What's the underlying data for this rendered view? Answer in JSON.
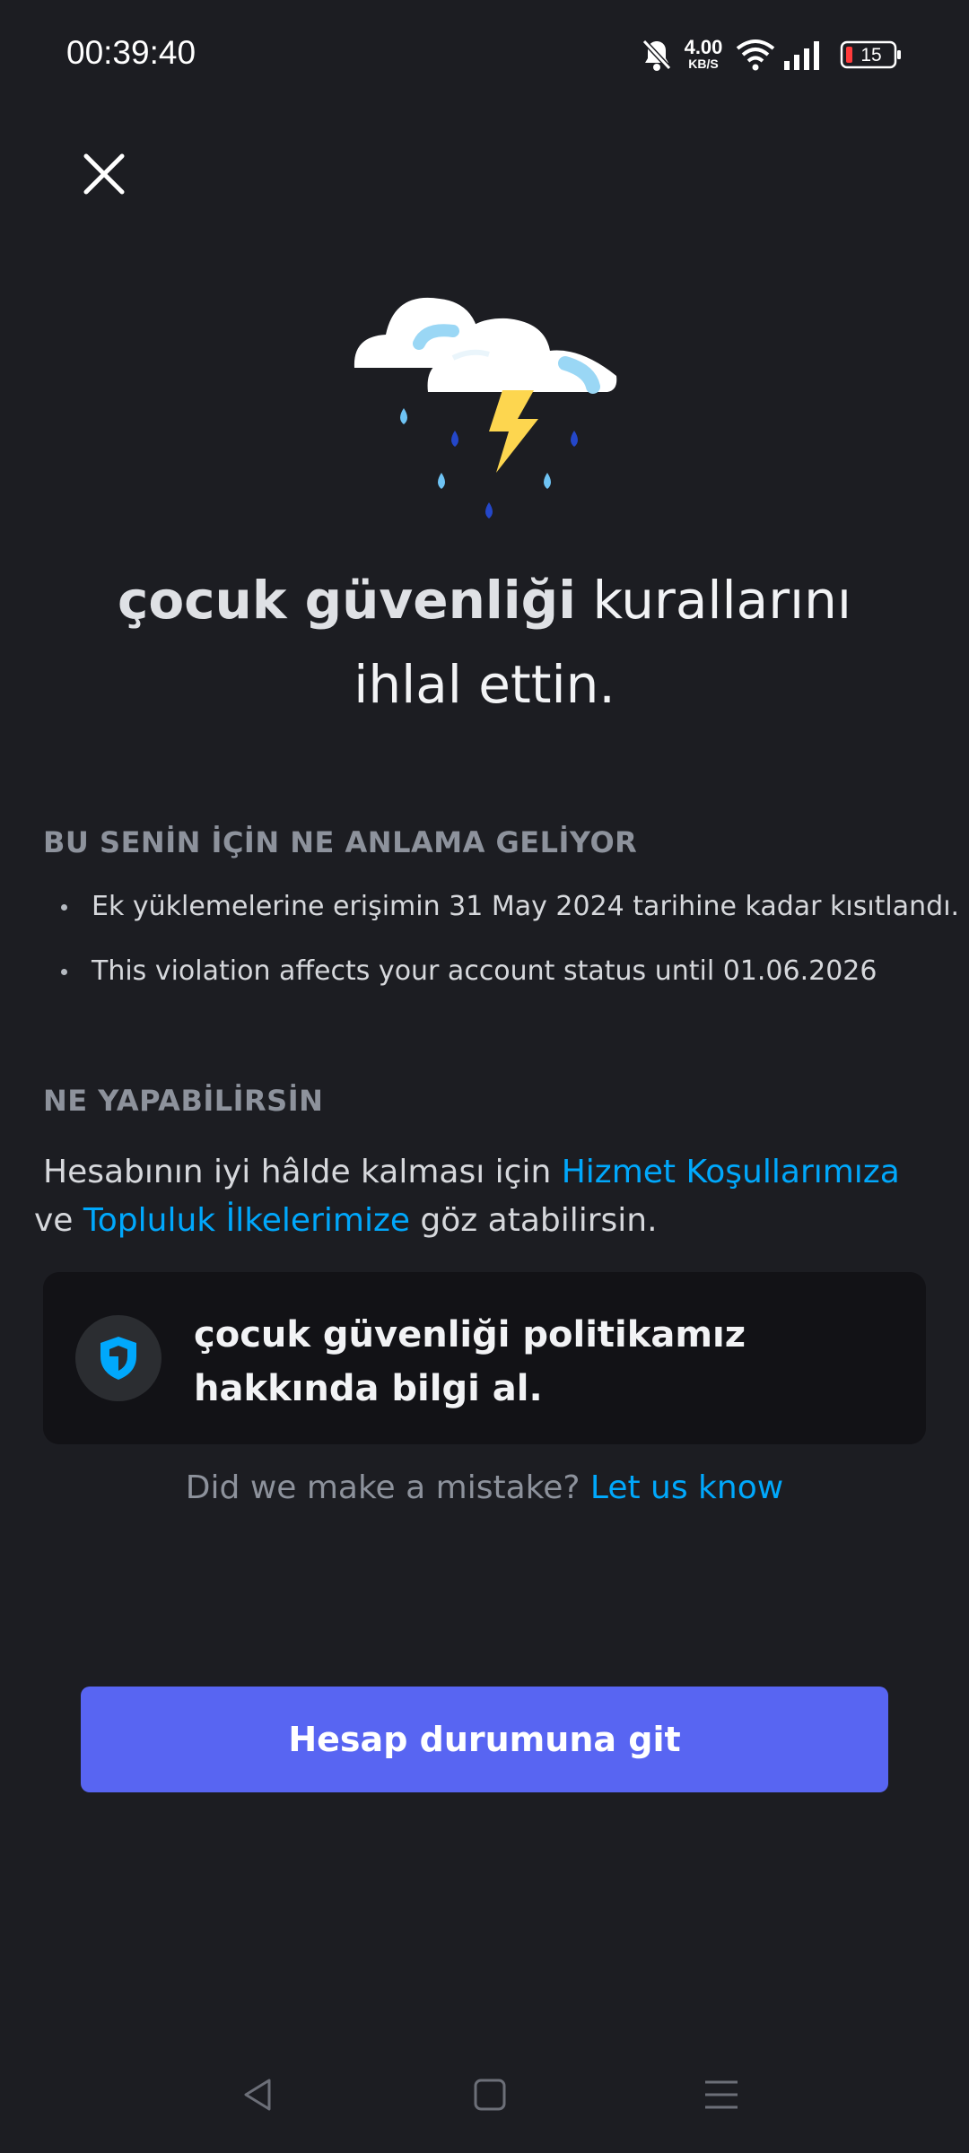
{
  "status_bar": {
    "time": "00:39:40",
    "net_speed_value": "4.00",
    "net_speed_unit": "KB/S",
    "battery_level": "15",
    "icons": [
      "bell-muted-icon",
      "wifi-icon",
      "signal-icon",
      "battery-icon"
    ]
  },
  "header": {
    "close_icon": "close-icon"
  },
  "hero": {
    "icon": "storm-cloud-icon",
    "headline_bold": "çocuk güvenliği",
    "headline_rest": " kurallarını ihlal ettin."
  },
  "meaning_section": {
    "title": "BU SENİN İÇİN NE ANLAMA GELİYOR",
    "items": [
      "Ek yüklemelerine erişimin 31 May 2024 tarihine kadar kısıtlandı.",
      "This violation affects your account status until 01.06.2026"
    ]
  },
  "actions_section": {
    "title": "NE YAPABİLİRSİN",
    "para_prefix": "Hesabının iyi hâlde kalması için ",
    "tos_link": "Hizmet Koşullarımıza",
    "para_mid": " ve ",
    "guidelines_link": "Topluluk İlkelerimize",
    "para_suffix": " göz atabilirsin."
  },
  "policy_card": {
    "icon": "shield-icon",
    "text": "çocuk güvenliği politikamız hakkında bilgi al."
  },
  "mistake": {
    "text": "Did we make a mistake? ",
    "link": "Let us know"
  },
  "primary_button": {
    "label": "Hesap durumuna git"
  },
  "colors": {
    "background": "#1c1d22",
    "card": "#121216",
    "accent": "#5865f2",
    "link": "#00a8fc",
    "muted": "#8d929c"
  }
}
